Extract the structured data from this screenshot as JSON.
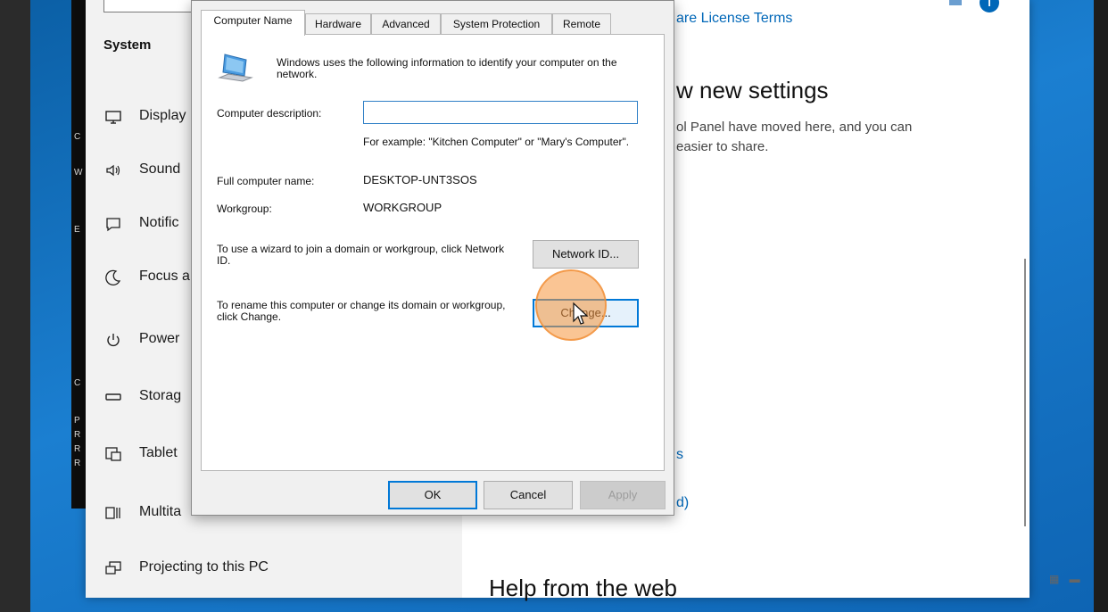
{
  "black_window": {
    "letters": [
      "C",
      "W",
      "E",
      "C",
      "P",
      "R",
      "R",
      "R"
    ]
  },
  "settings": {
    "nav": {
      "heading": "System",
      "items": [
        {
          "label": "Display",
          "icon": "monitor-icon"
        },
        {
          "label": "Sound",
          "icon": "speaker-icon"
        },
        {
          "label": "Notific",
          "icon": "notification-icon"
        },
        {
          "label": "Focus a",
          "icon": "moon-icon"
        },
        {
          "label": "Power",
          "icon": "power-icon"
        },
        {
          "label": "Storag",
          "icon": "storage-icon"
        },
        {
          "label": "Tablet",
          "icon": "tablet-icon"
        },
        {
          "label": "Multita",
          "icon": "multitasking-icon"
        },
        {
          "label": "Projecting to this PC",
          "icon": "projecting-icon"
        }
      ]
    },
    "content": {
      "license_link": "are License Terms",
      "new_settings_title": "w new settings",
      "new_settings_body": "ol Panel have moved here, and you can\neasier to share.",
      "link_s": "s",
      "link_d": "d)",
      "help_title": "Help from the web"
    }
  },
  "dialog": {
    "tabs": [
      "Computer Name",
      "Hardware",
      "Advanced",
      "System Protection",
      "Remote"
    ],
    "active_tab": "Computer Name",
    "intro": "Windows uses the following information to identify your computer on the network.",
    "description_label": "Computer description:",
    "description_value": "",
    "example": "For example: \"Kitchen Computer\" or \"Mary's Computer\".",
    "full_name_label": "Full computer name:",
    "full_name_value": "DESKTOP-UNT3SOS",
    "workgroup_label": "Workgroup:",
    "workgroup_value": "WORKGROUP",
    "wizard_text": "To use a wizard to join a domain or workgroup, click Network ID.",
    "network_id_button": "Network ID...",
    "rename_text": "To rename this computer or change its domain or workgroup, click Change.",
    "change_button": "Change...",
    "ok_button": "OK",
    "cancel_button": "Cancel",
    "apply_button": "Apply"
  },
  "colors": {
    "accent": "#0078d7",
    "link": "#0067b8",
    "click_highlight": "#f5963c"
  }
}
